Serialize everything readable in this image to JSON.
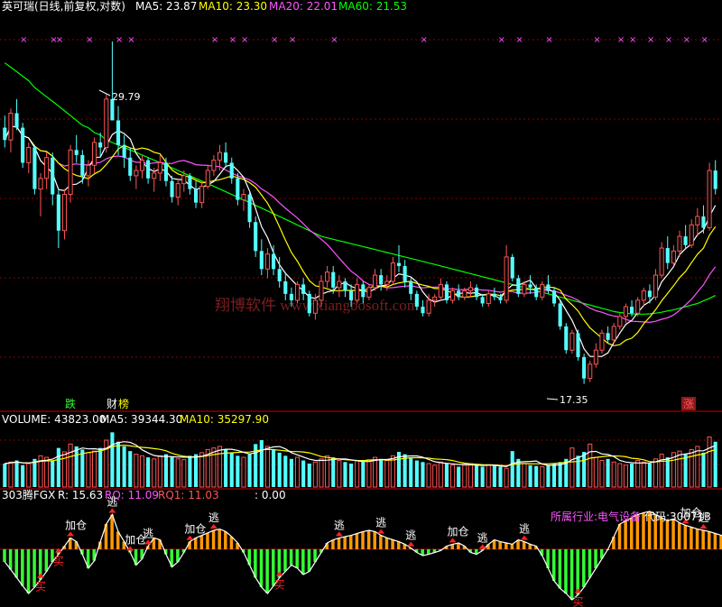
{
  "colors": {
    "up": "#ff5555",
    "down": "#54ffff",
    "ma5": "#ffffff",
    "ma10": "#ffff00",
    "ma20": "#ff55ff",
    "ma60": "#00ff00",
    "grid": "#8b0000",
    "marker": "#ff55ff",
    "ind_pos": "#ff9900",
    "ind_neg": "#33ff33",
    "signal": "#ff2222"
  },
  "price_panel": {
    "title": "英可瑞(日线,前复权,对数)",
    "ma_labels": [
      {
        "text": "MA5: 23.87",
        "color": "#ffffff"
      },
      {
        "text": "MA10: 23.30",
        "color": "#ffff00"
      },
      {
        "text": "MA20: 22.01",
        "color": "#ff55ff"
      },
      {
        "text": "MA60: 21.53",
        "color": "#00ff00"
      }
    ],
    "high_label": "29.79",
    "low_label": "17.35",
    "watermark": "翔博软件 www.xiangbosoft.com",
    "event_tags": [
      {
        "text": "跌",
        "color": "#33ff33"
      },
      {
        "text": "财",
        "color": "#ffffff"
      },
      {
        "text": "榜",
        "color": "#ffff00"
      },
      {
        "text": "涨",
        "color": "#ff5555"
      }
    ],
    "top_marker": "×"
  },
  "volume_panel": {
    "labels": [
      {
        "text": "VOLUME: 43823.00",
        "color": "#ffffff"
      },
      {
        "text": "MA5: 39344.30",
        "color": "#ffffff"
      },
      {
        "text": "MA10: 35297.90",
        "color": "#ffff00"
      }
    ]
  },
  "indicator_panel": {
    "labels": [
      {
        "text": "303腾FGX",
        "color": "#ffffff"
      },
      {
        "text": "R: 15.63",
        "color": "#ffffff"
      },
      {
        "text": "RQ: 11.09",
        "color": "#ff55ff"
      },
      {
        "text": "RQ1: 11.03",
        "color": "#ff5555"
      },
      {
        "text": ": 0.00",
        "color": "#ffffff"
      }
    ],
    "industry_label": "所属行业:电气设备",
    "code_label": "代码:300713",
    "signals": {
      "escape": "逃",
      "add": "加仓",
      "buy": "买"
    }
  },
  "chart_data": {
    "type": "candlestick",
    "title": "英可瑞(日线,前复权,对数)",
    "price_high": 29.79,
    "price_low": 17.35,
    "ylim": [
      17.0,
      31.0
    ],
    "x_count": 120,
    "ohlc": [
      [
        26.0,
        26.5,
        25.2,
        25.5
      ],
      [
        25.5,
        26.8,
        25.0,
        26.6
      ],
      [
        26.6,
        27.2,
        25.9,
        26.0
      ],
      [
        26.0,
        26.2,
        24.4,
        24.6
      ],
      [
        24.6,
        25.4,
        24.2,
        25.2
      ],
      [
        25.2,
        25.3,
        23.4,
        23.6
      ],
      [
        23.6,
        24.2,
        22.6,
        24.0
      ],
      [
        24.0,
        25.0,
        23.6,
        24.8
      ],
      [
        24.8,
        25.0,
        23.0,
        23.4
      ],
      [
        23.4,
        23.6,
        21.5,
        22.1
      ],
      [
        22.1,
        23.6,
        21.8,
        23.4
      ],
      [
        23.4,
        25.3,
        23.1,
        25.1
      ],
      [
        25.1,
        25.7,
        24.6,
        24.9
      ],
      [
        24.9,
        25.1,
        23.8,
        24.1
      ],
      [
        24.1,
        24.7,
        23.7,
        24.5
      ],
      [
        24.5,
        25.6,
        24.2,
        25.4
      ],
      [
        25.4,
        25.8,
        24.8,
        25.2
      ],
      [
        25.2,
        27.4,
        25.0,
        27.2
      ],
      [
        27.2,
        29.79,
        26.5,
        26.3
      ],
      [
        26.3,
        26.9,
        24.9,
        25.3
      ],
      [
        25.3,
        25.7,
        24.4,
        24.8
      ],
      [
        24.8,
        25.2,
        23.9,
        24.1
      ],
      [
        24.1,
        24.5,
        23.6,
        24.3
      ],
      [
        24.3,
        24.9,
        24.0,
        24.7
      ],
      [
        24.7,
        24.8,
        23.8,
        24.0
      ],
      [
        24.0,
        24.4,
        23.5,
        24.2
      ],
      [
        24.2,
        24.9,
        23.9,
        24.6
      ],
      [
        24.6,
        24.8,
        23.7,
        23.9
      ],
      [
        23.9,
        24.1,
        23.1,
        23.3
      ],
      [
        23.3,
        24.0,
        23.0,
        23.8
      ],
      [
        23.8,
        24.3,
        23.5,
        24.1
      ],
      [
        24.1,
        24.2,
        23.4,
        23.6
      ],
      [
        23.6,
        23.9,
        22.9,
        23.1
      ],
      [
        23.1,
        23.9,
        22.9,
        23.7
      ],
      [
        23.7,
        24.5,
        23.6,
        24.3
      ],
      [
        24.3,
        24.9,
        24.1,
        24.7
      ],
      [
        24.7,
        25.3,
        24.3,
        25.0
      ],
      [
        25.0,
        25.4,
        24.4,
        24.6
      ],
      [
        24.6,
        24.8,
        23.8,
        24.0
      ],
      [
        24.0,
        24.2,
        23.0,
        23.2
      ],
      [
        23.2,
        23.6,
        22.8,
        23.4
      ],
      [
        23.4,
        23.5,
        22.2,
        22.4
      ],
      [
        22.4,
        22.6,
        21.2,
        21.4
      ],
      [
        21.4,
        21.8,
        20.6,
        20.8
      ],
      [
        20.8,
        21.5,
        20.5,
        21.3
      ],
      [
        21.3,
        21.6,
        20.6,
        20.8
      ],
      [
        20.8,
        21.2,
        20.2,
        20.4
      ],
      [
        20.4,
        20.7,
        19.8,
        20.0
      ],
      [
        20.0,
        20.2,
        19.6,
        19.8
      ],
      [
        19.8,
        20.4,
        19.7,
        20.3
      ],
      [
        20.3,
        20.5,
        19.8,
        20.0
      ],
      [
        20.0,
        20.1,
        19.3,
        19.4
      ],
      [
        19.4,
        20.0,
        19.2,
        19.8
      ],
      [
        19.8,
        20.6,
        19.6,
        20.4
      ],
      [
        20.4,
        20.9,
        20.2,
        20.7
      ],
      [
        20.7,
        20.9,
        20.0,
        20.2
      ],
      [
        20.2,
        20.6,
        19.9,
        20.4
      ],
      [
        20.4,
        20.5,
        19.9,
        20.1
      ],
      [
        20.1,
        20.3,
        19.6,
        19.8
      ],
      [
        19.8,
        20.5,
        19.7,
        20.3
      ],
      [
        20.3,
        20.4,
        19.7,
        19.9
      ],
      [
        19.9,
        20.3,
        19.8,
        20.2
      ],
      [
        20.2,
        20.8,
        20.1,
        20.6
      ],
      [
        20.6,
        20.8,
        20.1,
        20.3
      ],
      [
        20.3,
        20.6,
        20.1,
        20.4
      ],
      [
        20.4,
        21.2,
        20.3,
        21.0
      ],
      [
        21.0,
        21.6,
        20.7,
        20.9
      ],
      [
        20.9,
        21.1,
        20.2,
        20.4
      ],
      [
        20.4,
        20.5,
        19.8,
        20.0
      ],
      [
        20.0,
        20.1,
        19.5,
        19.6
      ],
      [
        19.6,
        19.8,
        19.3,
        19.4
      ],
      [
        19.4,
        20.0,
        19.3,
        19.8
      ],
      [
        19.8,
        20.0,
        19.6,
        19.9
      ],
      [
        19.9,
        20.5,
        19.8,
        20.3
      ],
      [
        20.3,
        20.4,
        19.7,
        19.8
      ],
      [
        19.8,
        20.2,
        19.7,
        20.1
      ],
      [
        20.1,
        20.3,
        19.8,
        19.9
      ],
      [
        19.9,
        20.2,
        19.8,
        20.1
      ],
      [
        20.1,
        20.4,
        19.9,
        20.2
      ],
      [
        20.2,
        20.3,
        19.8,
        19.9
      ],
      [
        19.9,
        20.0,
        19.6,
        19.7
      ],
      [
        19.7,
        20.1,
        19.6,
        20.0
      ],
      [
        20.0,
        20.2,
        19.8,
        19.9
      ],
      [
        19.9,
        20.0,
        19.7,
        19.8
      ],
      [
        19.8,
        21.6,
        19.7,
        21.2
      ],
      [
        21.2,
        21.3,
        20.4,
        20.5
      ],
      [
        20.5,
        20.6,
        19.9,
        20.0
      ],
      [
        20.0,
        20.4,
        19.9,
        20.3
      ],
      [
        20.3,
        20.6,
        20.0,
        20.2
      ],
      [
        20.2,
        20.3,
        19.8,
        19.9
      ],
      [
        19.9,
        20.4,
        19.8,
        20.3
      ],
      [
        20.3,
        20.6,
        20.0,
        20.1
      ],
      [
        20.1,
        20.2,
        19.6,
        19.7
      ],
      [
        19.7,
        19.8,
        18.9,
        19.0
      ],
      [
        19.0,
        19.1,
        18.2,
        18.3
      ],
      [
        18.3,
        18.9,
        18.2,
        18.8
      ],
      [
        18.8,
        18.9,
        18.0,
        18.1
      ],
      [
        18.1,
        18.2,
        17.35,
        17.5
      ],
      [
        17.5,
        18.0,
        17.4,
        17.9
      ],
      [
        17.9,
        18.5,
        17.8,
        18.3
      ],
      [
        18.3,
        18.9,
        18.2,
        18.8
      ],
      [
        18.8,
        19.0,
        18.5,
        18.6
      ],
      [
        18.6,
        19.1,
        18.5,
        19.0
      ],
      [
        19.0,
        19.4,
        18.9,
        19.3
      ],
      [
        19.3,
        19.7,
        19.1,
        19.6
      ],
      [
        19.6,
        19.8,
        19.3,
        19.4
      ],
      [
        19.4,
        19.9,
        19.3,
        19.8
      ],
      [
        19.8,
        20.2,
        19.6,
        20.1
      ],
      [
        20.1,
        20.3,
        19.7,
        19.9
      ],
      [
        19.9,
        20.8,
        19.8,
        20.6
      ],
      [
        20.6,
        21.7,
        20.5,
        21.5
      ],
      [
        21.5,
        21.9,
        20.8,
        21.0
      ],
      [
        21.0,
        21.6,
        20.9,
        21.4
      ],
      [
        21.4,
        22.1,
        21.2,
        21.9
      ],
      [
        21.9,
        22.3,
        21.5,
        21.6
      ],
      [
        21.6,
        22.5,
        21.5,
        22.3
      ],
      [
        22.3,
        22.9,
        21.9,
        22.6
      ],
      [
        22.6,
        23.0,
        22.0,
        22.2
      ],
      [
        22.2,
        24.6,
        22.1,
        24.3
      ],
      [
        24.3,
        24.7,
        23.4,
        23.6
      ]
    ],
    "ma60": [
      28.8,
      28.6,
      28.4,
      28.2,
      28.0,
      27.7,
      27.5,
      27.3,
      27.1,
      26.9,
      26.7,
      26.5,
      26.3,
      26.1,
      26.0,
      25.8,
      25.7,
      25.5,
      25.4,
      25.3,
      25.2,
      25.1,
      25.0,
      24.9,
      24.8,
      24.7,
      24.6,
      24.5,
      24.4,
      24.3,
      24.2,
      24.1,
      24.0,
      23.9,
      23.8,
      23.7,
      23.6,
      23.5,
      23.4,
      23.3,
      23.2,
      23.1,
      23.0,
      22.9,
      22.8,
      22.7,
      22.6,
      22.5,
      22.4,
      22.3,
      22.2,
      22.1,
      22.0,
      21.9,
      21.85,
      21.8,
      21.75,
      21.7,
      21.65,
      21.6,
      21.55,
      21.5,
      21.45,
      21.4,
      21.35,
      21.3,
      21.25,
      21.2,
      21.15,
      21.1,
      21.05,
      21.0,
      20.95,
      20.9,
      20.85,
      20.8,
      20.75,
      20.7,
      20.65,
      20.6,
      20.55,
      20.5,
      20.45,
      20.4,
      20.35,
      20.3,
      20.25,
      20.2,
      20.15,
      20.1,
      20.05,
      20.0,
      19.95,
      19.9,
      19.85,
      19.8,
      19.75,
      19.7,
      19.65,
      19.6,
      19.55,
      19.5,
      19.45,
      19.42,
      19.4,
      19.38,
      19.37,
      19.37,
      19.38,
      19.4,
      19.43,
      19.47,
      19.5,
      19.55,
      19.6,
      19.65,
      19.7,
      19.78,
      19.86,
      19.95
    ],
    "volume": [
      30,
      32,
      34,
      28,
      30,
      36,
      40,
      38,
      34,
      50,
      45,
      55,
      52,
      48,
      44,
      46,
      50,
      60,
      70,
      58,
      52,
      46,
      42,
      40,
      38,
      36,
      40,
      42,
      38,
      36,
      35,
      40,
      42,
      44,
      48,
      50,
      52,
      48,
      44,
      40,
      38,
      42,
      55,
      60,
      52,
      48,
      44,
      40,
      36,
      38,
      34,
      30,
      32,
      36,
      40,
      38,
      34,
      32,
      30,
      34,
      33,
      35,
      38,
      36,
      34,
      40,
      45,
      42,
      38,
      34,
      32,
      30,
      28,
      32,
      30,
      28,
      26,
      28,
      30,
      28,
      26,
      28,
      27,
      26,
      24,
      46,
      36,
      30,
      28,
      27,
      26,
      28,
      30,
      32,
      36,
      50,
      40,
      45,
      55,
      38,
      34,
      36,
      32,
      30,
      28,
      30,
      34,
      32,
      30,
      36,
      42,
      38,
      44,
      46,
      42,
      48,
      52,
      44,
      64,
      58
    ],
    "volume_ylim": [
      0,
      75
    ],
    "indicator": [
      -20,
      -32,
      -45,
      -58,
      -70,
      -60,
      -48,
      -35,
      -20,
      -8,
      5,
      18,
      12,
      -8,
      -30,
      -18,
      12,
      40,
      55,
      28,
      12,
      -5,
      -25,
      -15,
      5,
      18,
      15,
      -8,
      -28,
      -20,
      -5,
      12,
      18,
      22,
      26,
      30,
      32,
      28,
      20,
      10,
      -5,
      -25,
      -45,
      -60,
      -70,
      -58,
      -45,
      -35,
      -25,
      -30,
      -40,
      -35,
      -20,
      -5,
      10,
      15,
      18,
      20,
      22,
      25,
      28,
      30,
      28,
      22,
      18,
      15,
      12,
      8,
      2,
      -5,
      -10,
      -8,
      -5,
      -2,
      5,
      8,
      10,
      5,
      -5,
      -8,
      -2,
      8,
      15,
      12,
      10,
      8,
      15,
      12,
      8,
      5,
      -10,
      -30,
      -50,
      -62,
      -70,
      -80,
      -72,
      -60,
      -45,
      -30,
      -15,
      0,
      20,
      40,
      45,
      50,
      55,
      58,
      60,
      55,
      50,
      45,
      48,
      42,
      38,
      35,
      32,
      30,
      28,
      25,
      22,
      20
    ],
    "indicator_ylim": [
      -90,
      70
    ]
  }
}
